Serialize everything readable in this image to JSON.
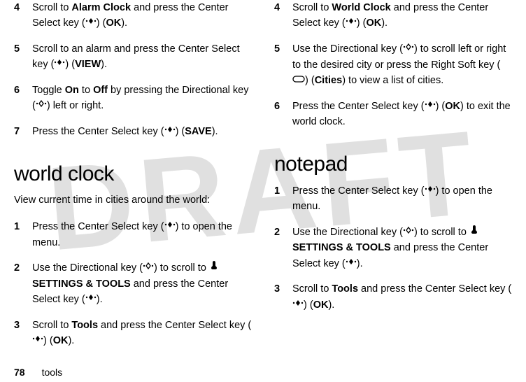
{
  "watermark": "DRAFT",
  "left": {
    "steps_a": [
      {
        "n": "4",
        "pre": "Scroll to ",
        "bold1": "Alarm Clock",
        "mid1": " and press the Center Select key (",
        "mid2": ") (",
        "bold2": "OK",
        "post": ")."
      },
      {
        "n": "5",
        "pre": "Scroll to an alarm and press the Center Select key (",
        "mid2": ") (",
        "bold2": "VIEW",
        "post": ")."
      },
      {
        "n": "6",
        "pre": "Toggle ",
        "bold1": "On",
        "mid1": " to ",
        "bold2": "Off",
        "post": " by pressing the Directional key (",
        "end": ") left or right."
      },
      {
        "n": "7",
        "pre": "Press the Center Select key (",
        "mid2": ") (",
        "bold2": "SAVE",
        "post": ")."
      }
    ],
    "heading": "world clock",
    "intro": "View current time in cities around the world:",
    "steps_b": [
      {
        "n": "1",
        "pre": "Press the Center Select key (",
        "post": ") to open the menu."
      },
      {
        "n": "2",
        "pre": "Use the Directional key (",
        "mid": ") to scroll to ",
        "bold": "SETTINGS & TOOLS",
        "post": " and press the Center Select key (",
        "end": ")."
      },
      {
        "n": "3",
        "pre": "Scroll to ",
        "bold1": "Tools",
        "mid1": " and press the Center Select key (",
        "mid2": ") (",
        "bold2": "OK",
        "post": ")."
      }
    ]
  },
  "right": {
    "steps_a": [
      {
        "n": "4",
        "pre": "Scroll to ",
        "bold1": "World Clock",
        "mid1": " and press the Center Select key (",
        "mid2": ") (",
        "bold2": "OK",
        "post": ")."
      },
      {
        "n": "5",
        "pre": "Use the Directional key (",
        "mid": ") to scroll left or right to the desired city or press the Right Soft key (",
        "mid2": ") (",
        "bold2": "Cities",
        "post": ") to view a list of cities."
      },
      {
        "n": "6",
        "pre": "Press the Center Select key (",
        "mid2": ") (",
        "bold2": "OK",
        "post": ") to exit the world clock."
      }
    ],
    "heading": "notepad",
    "steps_b": [
      {
        "n": "1",
        "pre": "Press the Center Select key (",
        "post": ") to open the menu."
      },
      {
        "n": "2",
        "pre": "Use the Directional key (",
        "mid": ") to scroll to ",
        "bold": "SETTINGS & TOOLS",
        "post": " and press the Center Select key (",
        "end": ")."
      },
      {
        "n": "3",
        "pre": "Scroll to ",
        "bold1": "Tools",
        "mid1": " and press the Center Select key (",
        "mid2": ") (",
        "bold2": "OK",
        "post": ")."
      }
    ]
  },
  "footer": {
    "page": "78",
    "label": "tools"
  }
}
